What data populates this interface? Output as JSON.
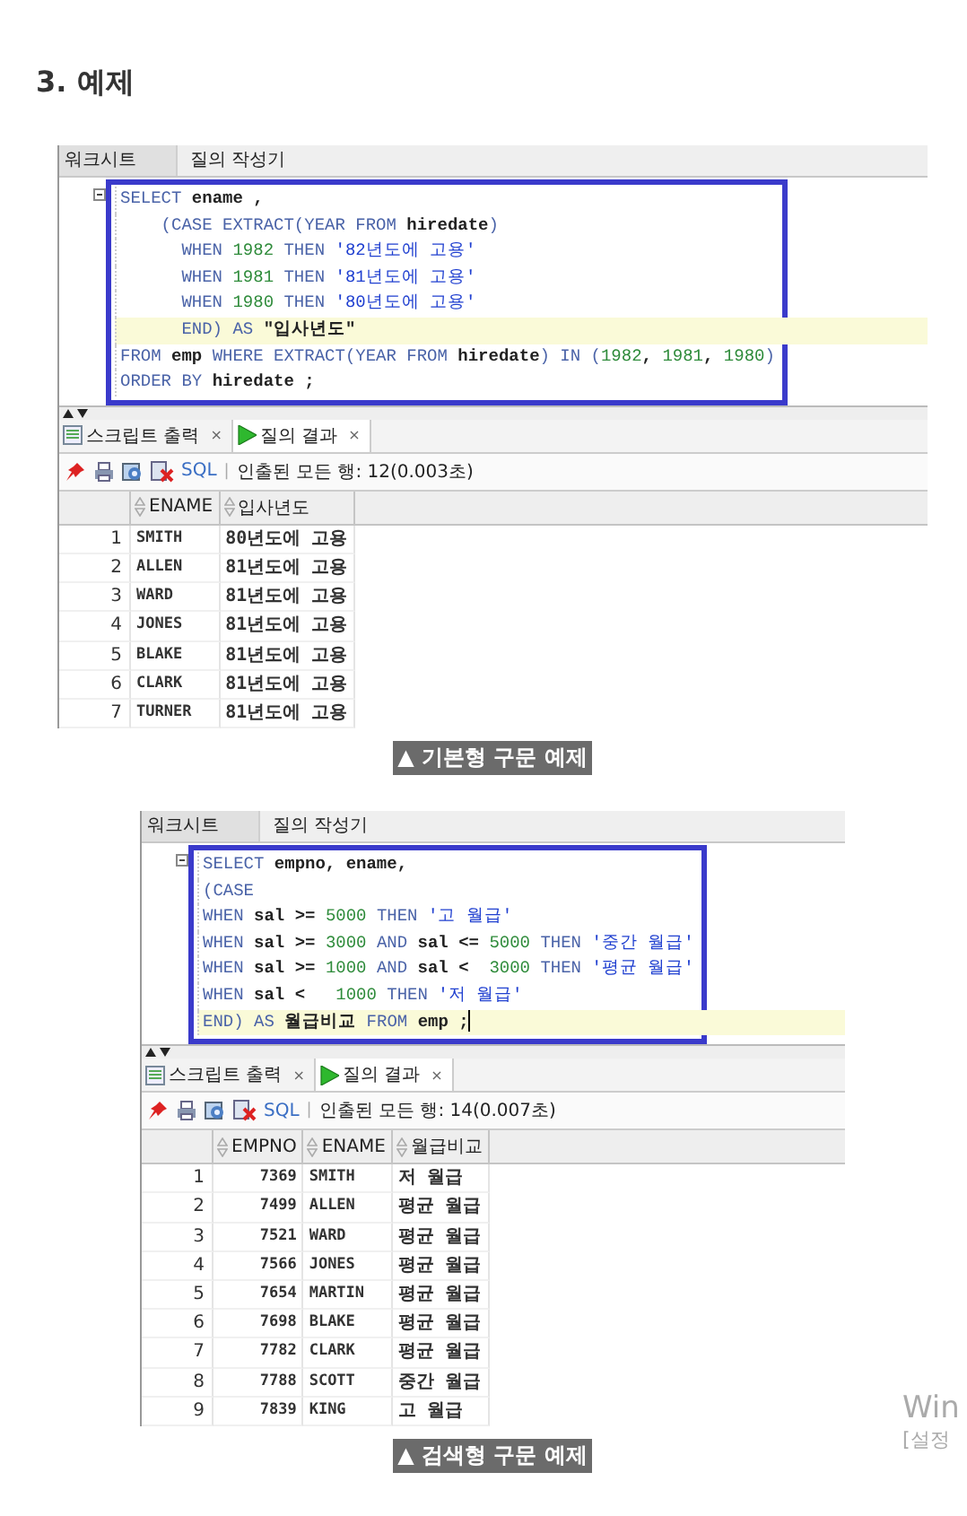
{
  "heading": "3. 예제",
  "figures": [
    {
      "editor_tabs": [
        {
          "label": "워크시트",
          "selected": true
        },
        {
          "label": "질의 작성기",
          "selected": false
        }
      ],
      "code_lines": [
        {
          "current": false,
          "tokens": [
            {
              "kind": "keyword",
              "text": "SELECT"
            },
            {
              "kind": "plain",
              "text": " ename ,"
            }
          ]
        },
        {
          "current": false,
          "tokens": [
            {
              "kind": "keyword",
              "text": "    (CASE EXTRACT(YEAR FROM "
            },
            {
              "kind": "plain",
              "text": "hiredate"
            },
            {
              "kind": "keyword",
              "text": ")"
            }
          ]
        },
        {
          "current": false,
          "tokens": [
            {
              "kind": "keyword",
              "text": "      WHEN "
            },
            {
              "kind": "number",
              "text": "1982"
            },
            {
              "kind": "keyword",
              "text": " THEN "
            },
            {
              "kind": "string",
              "text": "'82년도에 고용'"
            }
          ]
        },
        {
          "current": false,
          "tokens": [
            {
              "kind": "keyword",
              "text": "      WHEN "
            },
            {
              "kind": "number",
              "text": "1981"
            },
            {
              "kind": "keyword",
              "text": " THEN "
            },
            {
              "kind": "string",
              "text": "'81년도에 고용'"
            }
          ]
        },
        {
          "current": false,
          "tokens": [
            {
              "kind": "keyword",
              "text": "      WHEN "
            },
            {
              "kind": "number",
              "text": "1980"
            },
            {
              "kind": "keyword",
              "text": " THEN "
            },
            {
              "kind": "string",
              "text": "'80년도에 고용'"
            }
          ]
        },
        {
          "current": true,
          "tokens": [
            {
              "kind": "keyword",
              "text": "      END) AS "
            },
            {
              "kind": "plain",
              "text": "\"입사년도\""
            }
          ]
        },
        {
          "current": false,
          "tokens": [
            {
              "kind": "keyword",
              "text": "FROM "
            },
            {
              "kind": "plain",
              "text": "emp"
            },
            {
              "kind": "keyword",
              "text": " WHERE EXTRACT(YEAR FROM "
            },
            {
              "kind": "plain",
              "text": "hiredate"
            },
            {
              "kind": "keyword",
              "text": ") IN ("
            },
            {
              "kind": "number",
              "text": "1982"
            },
            {
              "kind": "plain",
              "text": ", "
            },
            {
              "kind": "number",
              "text": "1981"
            },
            {
              "kind": "plain",
              "text": ", "
            },
            {
              "kind": "number",
              "text": "1980"
            },
            {
              "kind": "keyword",
              "text": ")"
            }
          ]
        },
        {
          "current": false,
          "tokens": [
            {
              "kind": "keyword",
              "text": "ORDER BY "
            },
            {
              "kind": "plain",
              "text": "hiredate ;"
            }
          ]
        }
      ],
      "result_tabs": [
        {
          "label": "스크립트 출력",
          "close": "×",
          "selected": false
        },
        {
          "label": "질의 결과",
          "close": "×",
          "selected": true
        }
      ],
      "toolbar": {
        "sql": "SQL",
        "separator": "|",
        "status": "인출된 모든 행: 12(0.003초)"
      },
      "table": {
        "columns": [
          {
            "label": "ENAME",
            "kind": "text"
          },
          {
            "label": "입사년도",
            "kind": "text"
          }
        ],
        "rows": [
          {
            "number": "1",
            "cells": [
              "SMITH",
              "80년도에 고용"
            ]
          },
          {
            "number": "2",
            "cells": [
              "ALLEN",
              "81년도에 고용"
            ]
          },
          {
            "number": "3",
            "cells": [
              "WARD",
              "81년도에 고용"
            ]
          },
          {
            "number": "4",
            "cells": [
              "JONES",
              "81년도에 고용"
            ]
          },
          {
            "number": "5",
            "cells": [
              "BLAKE",
              "81년도에 고용"
            ]
          },
          {
            "number": "6",
            "cells": [
              "CLARK",
              "81년도에 고용"
            ]
          },
          {
            "number": "7",
            "cells": [
              "TURNER",
              "81년도에 고용"
            ]
          }
        ]
      },
      "caption": "▲ 기본형 구문 예제"
    },
    {
      "editor_tabs": [
        {
          "label": "워크시트",
          "selected": true
        },
        {
          "label": "질의 작성기",
          "selected": false
        }
      ],
      "code_lines": [
        {
          "current": false,
          "tokens": [
            {
              "kind": "keyword",
              "text": "SELECT "
            },
            {
              "kind": "plain",
              "text": "empno, ename,"
            }
          ]
        },
        {
          "current": false,
          "tokens": [
            {
              "kind": "keyword",
              "text": "(CASE"
            }
          ]
        },
        {
          "current": false,
          "tokens": [
            {
              "kind": "keyword",
              "text": "WHEN "
            },
            {
              "kind": "plain",
              "text": "sal >= "
            },
            {
              "kind": "number",
              "text": "5000"
            },
            {
              "kind": "keyword",
              "text": " THEN "
            },
            {
              "kind": "string",
              "text": "'고 월급'"
            }
          ]
        },
        {
          "current": false,
          "tokens": [
            {
              "kind": "keyword",
              "text": "WHEN "
            },
            {
              "kind": "plain",
              "text": "sal >= "
            },
            {
              "kind": "number",
              "text": "3000"
            },
            {
              "kind": "keyword",
              "text": " AND "
            },
            {
              "kind": "plain",
              "text": "sal <= "
            },
            {
              "kind": "number",
              "text": "5000"
            },
            {
              "kind": "keyword",
              "text": " THEN "
            },
            {
              "kind": "string",
              "text": "'중간 월급'"
            }
          ]
        },
        {
          "current": false,
          "tokens": [
            {
              "kind": "keyword",
              "text": "WHEN "
            },
            {
              "kind": "plain",
              "text": "sal >= "
            },
            {
              "kind": "number",
              "text": "1000"
            },
            {
              "kind": "keyword",
              "text": " AND "
            },
            {
              "kind": "plain",
              "text": "sal <  "
            },
            {
              "kind": "number",
              "text": "3000"
            },
            {
              "kind": "keyword",
              "text": " THEN "
            },
            {
              "kind": "string",
              "text": "'평균 월급'"
            }
          ]
        },
        {
          "current": false,
          "tokens": [
            {
              "kind": "keyword",
              "text": "WHEN "
            },
            {
              "kind": "plain",
              "text": "sal <   "
            },
            {
              "kind": "number",
              "text": "1000"
            },
            {
              "kind": "keyword",
              "text": " THEN "
            },
            {
              "kind": "string",
              "text": "'저 월급'"
            }
          ]
        },
        {
          "current": true,
          "cursor": true,
          "tokens": [
            {
              "kind": "keyword",
              "text": "END) AS "
            },
            {
              "kind": "plain",
              "text": "월급비교"
            },
            {
              "kind": "keyword",
              "text": " FROM "
            },
            {
              "kind": "plain",
              "text": "emp ;"
            }
          ]
        }
      ],
      "result_tabs": [
        {
          "label": "스크립트 출력",
          "close": "×",
          "selected": false
        },
        {
          "label": "질의 결과",
          "close": "×",
          "selected": true
        }
      ],
      "toolbar": {
        "sql": "SQL",
        "separator": "|",
        "status": "인출된 모든 행: 14(0.007초)"
      },
      "table": {
        "columns": [
          {
            "label": "EMPNO",
            "kind": "number"
          },
          {
            "label": "ENAME",
            "kind": "text"
          },
          {
            "label": "월급비교",
            "kind": "text"
          }
        ],
        "rows": [
          {
            "number": "1",
            "cells": [
              "7369",
              "SMITH",
              "저 월급"
            ]
          },
          {
            "number": "2",
            "cells": [
              "7499",
              "ALLEN",
              "평균 월급"
            ]
          },
          {
            "number": "3",
            "cells": [
              "7521",
              "WARD",
              "평균 월급"
            ]
          },
          {
            "number": "4",
            "cells": [
              "7566",
              "JONES",
              "평균 월급"
            ]
          },
          {
            "number": "5",
            "cells": [
              "7654",
              "MARTIN",
              "평균 월급"
            ]
          },
          {
            "number": "6",
            "cells": [
              "7698",
              "BLAKE",
              "평균 월급"
            ]
          },
          {
            "number": "7",
            "cells": [
              "7782",
              "CLARK",
              "평균 월급"
            ]
          },
          {
            "number": "8",
            "cells": [
              "7788",
              "SCOTT",
              "중간 월급"
            ]
          },
          {
            "number": "9",
            "cells": [
              "7839",
              "KING",
              "고 월급"
            ]
          }
        ]
      },
      "caption": "▲ 검색형 구문 예제"
    }
  ],
  "activation_notice": {
    "title": "Win",
    "subtitle": "[설정"
  }
}
